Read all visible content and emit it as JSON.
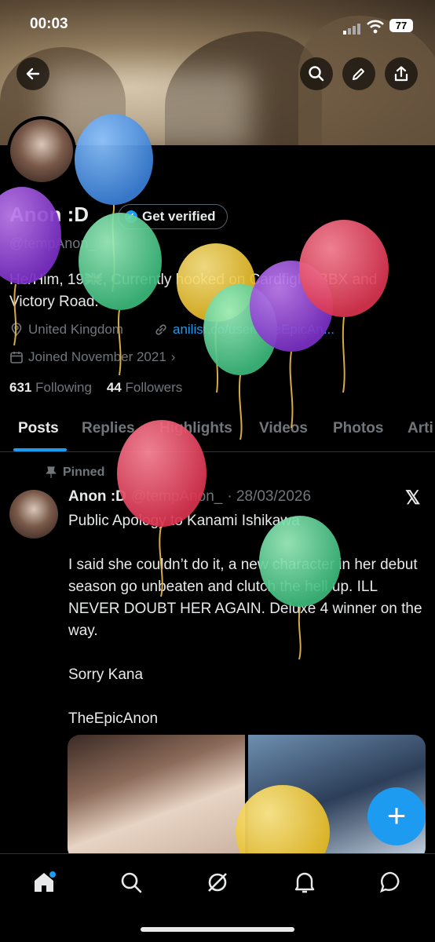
{
  "status_bar": {
    "time": "00:03",
    "battery": "77"
  },
  "profile": {
    "name": "Anon :D",
    "verify_label": "Get verified",
    "handle": "@tempAnon_",
    "bio_line1": "He/Him, 19🇬🇧, Currently hooked on Cardfight, BBX and",
    "bio_line2": "Victory Road.",
    "location": "United Kingdom",
    "website": "anilist.co/user/TheEpicAn...",
    "joined": "Joined November 2021",
    "following_count": "631",
    "following_label": "Following",
    "followers_count": "44",
    "followers_label": "Followers"
  },
  "tabs": [
    "Posts",
    "Replies",
    "Highlights",
    "Videos",
    "Photos",
    "Arti"
  ],
  "post": {
    "pinned_label": "Pinned",
    "author_name": "Anon :D",
    "author_handle": "@tempAnon_",
    "date": "· 28/03/2026",
    "body": "Public Apology to Kanami Ishikawa\n\nI said she couldn’t do it, a new character in her debut season go unbeaten and clutch the hell up. ILL NEVER DOUBT HER AGAIN. Deluxe 4 winner on the way.\n\nSorry Kana\n\nTheEpicAnon"
  },
  "fab_label": "+",
  "icons": {
    "back": "arrow-left-icon",
    "search": "search-icon",
    "edit": "pencil-icon",
    "share": "share-icon",
    "location": "location-pin-icon",
    "link": "link-icon",
    "calendar": "calendar-icon",
    "pin": "pin-icon",
    "x": "x-logo-icon",
    "nav": [
      "home-icon",
      "search-icon",
      "grok-icon",
      "bell-icon",
      "messages-icon"
    ]
  },
  "colors": {
    "accent": "#1d9bf0",
    "muted": "#71767b",
    "text": "#e7e9ea",
    "background": "#000000"
  }
}
